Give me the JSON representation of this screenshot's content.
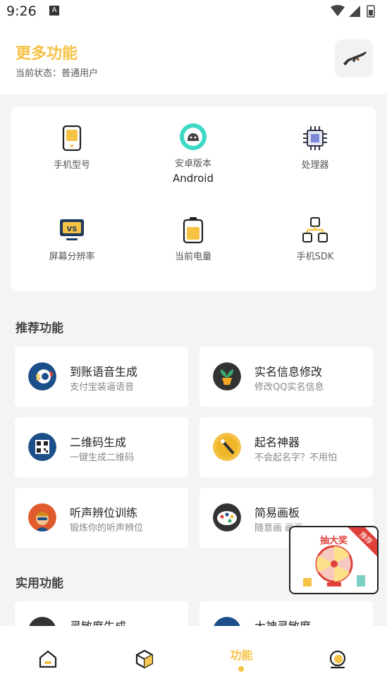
{
  "statusbar": {
    "time": "9:26",
    "notification_glyph": "A"
  },
  "header": {
    "title": "更多功能",
    "status": "当前状态：普通用户"
  },
  "device_info": [
    {
      "label": "手机型号",
      "value": ""
    },
    {
      "label": "安卓版本",
      "value": "Android"
    },
    {
      "label": "处理器",
      "value": ""
    },
    {
      "label": "屏幕分辨率",
      "value": ""
    },
    {
      "label": "当前电量",
      "value": ""
    },
    {
      "label": "手机SDK",
      "value": ""
    }
  ],
  "sections": {
    "recommended": "推荐功能",
    "practical": "实用功能"
  },
  "recommended": [
    {
      "name": "到账语音生成",
      "desc": "支付宝装逼语音"
    },
    {
      "name": "实名信息修改",
      "desc": "修改QQ实名信息"
    },
    {
      "name": "二维码生成",
      "desc": "一键生成二维码"
    },
    {
      "name": "起名神器",
      "desc": "不会起名字？不用怕"
    },
    {
      "name": "听声辨位训练",
      "desc": "锻炼你的听声辨位"
    },
    {
      "name": "简易画板",
      "desc": "随意画 画画"
    }
  ],
  "practical": [
    {
      "name": "灵敏度生成",
      "desc": ""
    },
    {
      "name": "大神灵敏度",
      "desc": ""
    }
  ],
  "promo": {
    "title": "抽大奖",
    "ribbon": "推荐"
  },
  "bottom_nav": {
    "active_label": "功能"
  },
  "colors": {
    "accent": "#f5c244",
    "background": "#f4f4f4"
  },
  "icons": {
    "header_button": "rifle-icon",
    "nav": [
      "home-icon",
      "cube-icon",
      "function-tab",
      "profile-icon"
    ]
  }
}
